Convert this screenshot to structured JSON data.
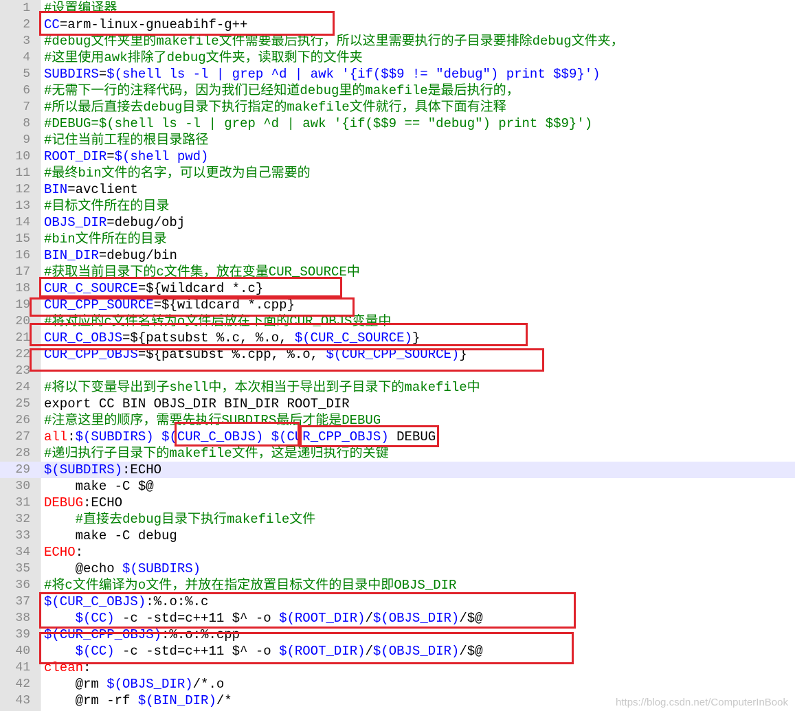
{
  "lines": [
    {
      "n": "1",
      "tokens": [
        {
          "t": "#设置编译器",
          "c": "c"
        }
      ]
    },
    {
      "n": "2",
      "tokens": [
        {
          "t": "CC",
          "c": "v"
        },
        {
          "t": "=arm-linux-gnueabihf-g++",
          "c": "k"
        }
      ]
    },
    {
      "n": "3",
      "tokens": [
        {
          "t": "#debug文件夹里的makefile文件需要最后执行，所以这里需要执行的子目录要排除debug文件夹，",
          "c": "c"
        }
      ]
    },
    {
      "n": "4",
      "tokens": [
        {
          "t": "#这里使用awk排除了debug文件夹，读取剩下的文件夹",
          "c": "c"
        }
      ]
    },
    {
      "n": "5",
      "tokens": [
        {
          "t": "SUBDIRS",
          "c": "v"
        },
        {
          "t": "=",
          "c": "k"
        },
        {
          "t": "$(shell ls -l | grep ^d | awk '{if($$9 != \"debug\") print $$9}')",
          "c": "v"
        }
      ]
    },
    {
      "n": "6",
      "tokens": [
        {
          "t": "#无需下一行的注释代码，因为我们已经知道debug里的makefile是最后执行的，",
          "c": "c"
        }
      ]
    },
    {
      "n": "7",
      "tokens": [
        {
          "t": "#所以最后直接去debug目录下执行指定的makefile文件就行，具体下面有注释",
          "c": "c"
        }
      ]
    },
    {
      "n": "8",
      "tokens": [
        {
          "t": "#DEBUG=$(shell ls -l | grep ^d | awk '{if($$9 == \"debug\") print $$9}')",
          "c": "c"
        }
      ]
    },
    {
      "n": "9",
      "tokens": [
        {
          "t": "#记住当前工程的根目录路径",
          "c": "c"
        }
      ]
    },
    {
      "n": "10",
      "tokens": [
        {
          "t": "ROOT_DIR",
          "c": "v"
        },
        {
          "t": "=",
          "c": "k"
        },
        {
          "t": "$(shell pwd)",
          "c": "v"
        }
      ]
    },
    {
      "n": "11",
      "tokens": [
        {
          "t": "#最终bin文件的名字，可以更改为自己需要的",
          "c": "c"
        }
      ]
    },
    {
      "n": "12",
      "tokens": [
        {
          "t": "BIN",
          "c": "v"
        },
        {
          "t": "=avclient",
          "c": "k"
        }
      ]
    },
    {
      "n": "13",
      "tokens": [
        {
          "t": "#目标文件所在的目录",
          "c": "c"
        }
      ]
    },
    {
      "n": "14",
      "tokens": [
        {
          "t": "OBJS_DIR",
          "c": "v"
        },
        {
          "t": "=debug/obj",
          "c": "k"
        }
      ]
    },
    {
      "n": "15",
      "tokens": [
        {
          "t": "#bin文件所在的目录",
          "c": "c"
        }
      ]
    },
    {
      "n": "16",
      "tokens": [
        {
          "t": "BIN_DIR",
          "c": "v"
        },
        {
          "t": "=debug/bin",
          "c": "k"
        }
      ]
    },
    {
      "n": "17",
      "tokens": [
        {
          "t": "#获取当前目录下的c文件集，放在变量CUR_SOURCE中",
          "c": "c"
        }
      ]
    },
    {
      "n": "18",
      "tokens": [
        {
          "t": "CUR_C_SOURCE",
          "c": "v"
        },
        {
          "t": "=${wildcard *.c}",
          "c": "k"
        }
      ]
    },
    {
      "n": "19",
      "tokens": [
        {
          "t": "CUR_CPP_SOURCE",
          "c": "v"
        },
        {
          "t": "=${wildcard *.cpp}",
          "c": "k"
        }
      ]
    },
    {
      "n": "20",
      "tokens": [
        {
          "t": "#将对应的c文件名转为o文件后放在下面的CUR_OBJS变量中",
          "c": "c"
        }
      ]
    },
    {
      "n": "21",
      "tokens": [
        {
          "t": "CUR_C_OBJS",
          "c": "v"
        },
        {
          "t": "=${patsubst %.c, %.o, ",
          "c": "k"
        },
        {
          "t": "$(CUR_C_SOURCE)",
          "c": "v"
        },
        {
          "t": "}",
          "c": "k"
        }
      ]
    },
    {
      "n": "22",
      "tokens": [
        {
          "t": "CUR_CPP_OBJS",
          "c": "v"
        },
        {
          "t": "=${patsubst %.cpp, %.o, ",
          "c": "k"
        },
        {
          "t": "$(CUR_CPP_SOURCE)",
          "c": "v"
        },
        {
          "t": "}",
          "c": "k"
        }
      ]
    },
    {
      "n": "23",
      "tokens": []
    },
    {
      "n": "24",
      "tokens": [
        {
          "t": "#将以下变量导出到子shell中，本次相当于导出到子目录下的makefile中",
          "c": "c"
        }
      ]
    },
    {
      "n": "25",
      "tokens": [
        {
          "t": "export CC BIN OBJS_DIR BIN_DIR ROOT_DIR",
          "c": "k"
        }
      ]
    },
    {
      "n": "26",
      "tokens": [
        {
          "t": "#注意这里的顺序，需要先执行SUBDIRS最后才能是DEBUG",
          "c": "c"
        }
      ]
    },
    {
      "n": "27",
      "tokens": [
        {
          "t": "all",
          "c": "t"
        },
        {
          "t": ":",
          "c": "k"
        },
        {
          "t": "$(SUBDIRS)",
          "c": "v"
        },
        {
          "t": " ",
          "c": "k"
        },
        {
          "t": "$(CUR_C_OBJS)",
          "c": "v"
        },
        {
          "t": " ",
          "c": "k"
        },
        {
          "t": "$(CUR_CPP_OBJS)",
          "c": "v"
        },
        {
          "t": " DEBUG",
          "c": "k"
        }
      ]
    },
    {
      "n": "28",
      "tokens": [
        {
          "t": "#递归执行子目录下的makefile文件，这是递归执行的关键",
          "c": "c"
        }
      ]
    },
    {
      "n": "29",
      "tokens": [
        {
          "t": "$(SUBDIRS)",
          "c": "v"
        },
        {
          "t": ":ECHO",
          "c": "k"
        }
      ]
    },
    {
      "n": "30",
      "tokens": [
        {
          "t": "    make -C $@",
          "c": "k"
        }
      ]
    },
    {
      "n": "31",
      "tokens": [
        {
          "t": "DEBUG",
          "c": "t"
        },
        {
          "t": ":ECHO",
          "c": "k"
        }
      ]
    },
    {
      "n": "32",
      "tokens": [
        {
          "t": "    ",
          "c": "k"
        },
        {
          "t": "#直接去debug目录下执行makefile文件",
          "c": "c"
        }
      ]
    },
    {
      "n": "33",
      "tokens": [
        {
          "t": "    make -C debug",
          "c": "k"
        }
      ]
    },
    {
      "n": "34",
      "tokens": [
        {
          "t": "ECHO",
          "c": "t"
        },
        {
          "t": ":",
          "c": "k"
        }
      ]
    },
    {
      "n": "35",
      "tokens": [
        {
          "t": "    @echo ",
          "c": "k"
        },
        {
          "t": "$(SUBDIRS)",
          "c": "v"
        }
      ]
    },
    {
      "n": "36",
      "tokens": [
        {
          "t": "#将c文件编译为o文件，并放在指定放置目标文件的目录中即OBJS_DIR",
          "c": "c"
        }
      ]
    },
    {
      "n": "37",
      "tokens": [
        {
          "t": "$(CUR_C_OBJS)",
          "c": "v"
        },
        {
          "t": ":%.o:%.c",
          "c": "k"
        }
      ]
    },
    {
      "n": "38",
      "tokens": [
        {
          "t": "    ",
          "c": "k"
        },
        {
          "t": "$(CC)",
          "c": "v"
        },
        {
          "t": " -c -std=c++11 $^ -o ",
          "c": "k"
        },
        {
          "t": "$(ROOT_DIR)",
          "c": "v"
        },
        {
          "t": "/",
          "c": "k"
        },
        {
          "t": "$(OBJS_DIR)",
          "c": "v"
        },
        {
          "t": "/$@",
          "c": "k"
        }
      ]
    },
    {
      "n": "39",
      "tokens": [
        {
          "t": "$(CUR_CPP_OBJS)",
          "c": "v"
        },
        {
          "t": ":%.o:%.cpp",
          "c": "k"
        }
      ]
    },
    {
      "n": "40",
      "tokens": [
        {
          "t": "    ",
          "c": "k"
        },
        {
          "t": "$(CC)",
          "c": "v"
        },
        {
          "t": " -c -std=c++11 $^ -o ",
          "c": "k"
        },
        {
          "t": "$(ROOT_DIR)",
          "c": "v"
        },
        {
          "t": "/",
          "c": "k"
        },
        {
          "t": "$(OBJS_DIR)",
          "c": "v"
        },
        {
          "t": "/$@",
          "c": "k"
        }
      ]
    },
    {
      "n": "41",
      "tokens": [
        {
          "t": "clean",
          "c": "t"
        },
        {
          "t": ":",
          "c": "k"
        }
      ]
    },
    {
      "n": "42",
      "tokens": [
        {
          "t": "    @rm ",
          "c": "k"
        },
        {
          "t": "$(OBJS_DIR)",
          "c": "v"
        },
        {
          "t": "/*.o",
          "c": "k"
        }
      ]
    },
    {
      "n": "43",
      "tokens": [
        {
          "t": "    @rm -rf ",
          "c": "k"
        },
        {
          "t": "$(BIN_DIR)",
          "c": "v"
        },
        {
          "t": "/*",
          "c": "k"
        }
      ]
    }
  ],
  "current_line": "29",
  "highlight_color": "#e0242c",
  "watermark": "https://blog.csdn.net/ComputerInBook"
}
